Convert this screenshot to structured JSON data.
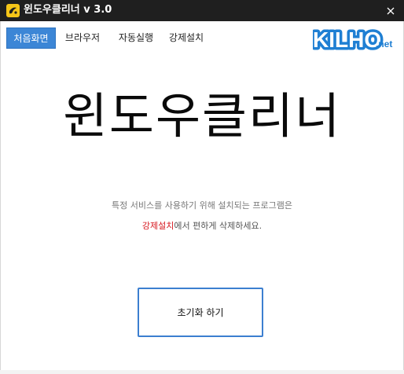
{
  "window": {
    "title": "윈도우클리너 v 3.0",
    "app_icon": "sparkle-app-icon",
    "close_icon": "close-icon"
  },
  "nav": {
    "tabs": [
      {
        "label": "처음화면",
        "active": true
      },
      {
        "label": "브라우저",
        "active": false
      },
      {
        "label": "자동실행",
        "active": false
      },
      {
        "label": "강제설치",
        "active": false
      }
    ]
  },
  "logo": {
    "text_main": "KILHO",
    "text_suffix": ".net",
    "color": "#1f7fd3"
  },
  "main": {
    "title": "윈도우클리너",
    "description_line1": "특정 서비스를 사용하기 위해 설치되는 프로그램은",
    "description_highlight": "강제설치",
    "description_rest": "에서 편하게 삭제하세요.",
    "highlight_color": "#d71920",
    "reset_button_label": "초기화 하기"
  }
}
